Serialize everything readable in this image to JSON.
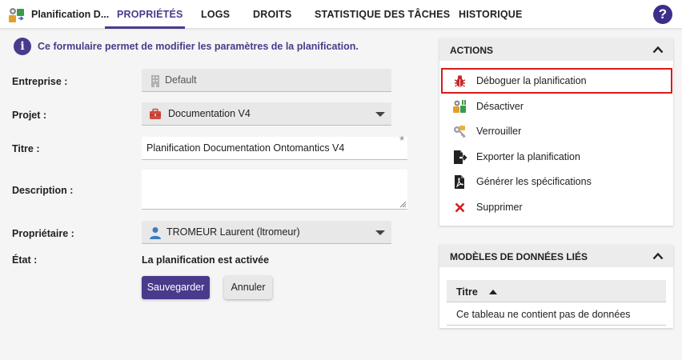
{
  "header": {
    "app_title": "Planification D...",
    "tabs": [
      {
        "label": "PROPRIÉTÉS",
        "active": true
      },
      {
        "label": "LOGS",
        "active": false
      },
      {
        "label": "DROITS",
        "active": false
      },
      {
        "label": "STATISTIQUE DES TÂCHES",
        "active": false
      },
      {
        "label": "HISTORIQUE",
        "active": false
      }
    ],
    "help_symbol": "?",
    "accent_color": "#4a3a8c"
  },
  "info": {
    "icon_symbol": "i",
    "text": "Ce formulaire permet de modifier les paramètres de la planification."
  },
  "form": {
    "company": {
      "label": "Entreprise :",
      "value": "Default",
      "icon": "building-icon",
      "disabled": true
    },
    "project": {
      "label": "Projet :",
      "value": "Documentation V4",
      "icon": "briefcase-icon"
    },
    "title": {
      "label": "Titre :",
      "value": "Planification Documentation Ontomantics V4",
      "required_marker": "*"
    },
    "description": {
      "label": "Description :",
      "value": ""
    },
    "owner": {
      "label": "Propriétaire :",
      "value": "TROMEUR Laurent (ltromeur)",
      "icon": "user-icon"
    },
    "state": {
      "label": "État :",
      "value": "La planification est activée"
    },
    "save_label": "Sauvegarder",
    "cancel_label": "Annuler"
  },
  "actions_panel": {
    "title": "ACTIONS",
    "items": [
      {
        "label": "Déboguer la planification",
        "icon": "bug-icon",
        "highlighted": true
      },
      {
        "label": "Désactiver",
        "icon": "deactivate-icon"
      },
      {
        "label": "Verrouiller",
        "icon": "key-icon"
      },
      {
        "label": "Exporter la planification",
        "icon": "export-icon"
      },
      {
        "label": "Générer les spécifications",
        "icon": "pdf-icon"
      },
      {
        "label": "Supprimer",
        "icon": "delete-icon",
        "color": "#d81c1c"
      }
    ],
    "highlight_color": "#d81c1c"
  },
  "models_panel": {
    "title": "MODÈLES DE DONNÉES LIÉS",
    "column_header": "Titre",
    "empty_text": "Ce tableau ne contient pas de données"
  }
}
